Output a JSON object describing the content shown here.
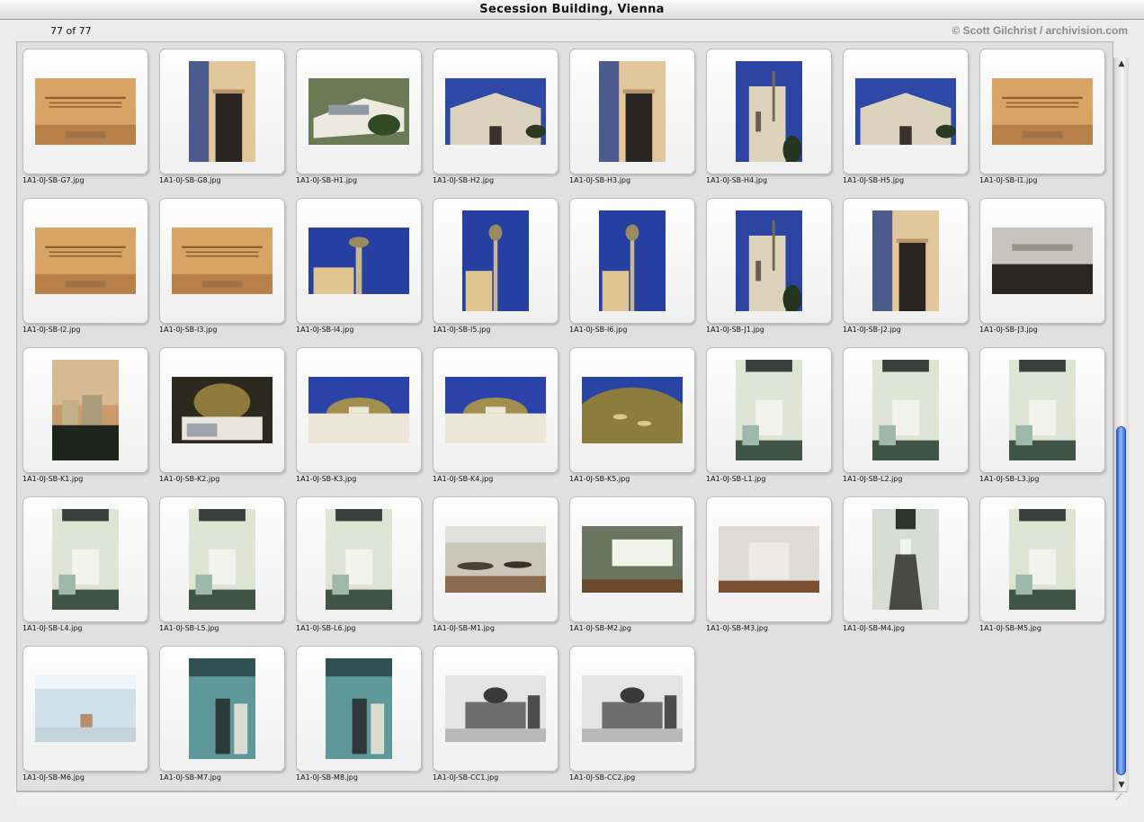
{
  "window": {
    "title": "Secession Building, Vienna"
  },
  "status": {
    "count": "77 of 77",
    "credit": "© Scott Gilchrist / archivision.com"
  },
  "thumbnails": [
    {
      "file": "1A1-0J-SB-G7.jpg",
      "orient": "land",
      "scene": "facade"
    },
    {
      "file": "1A1-0J-SB-G8.jpg",
      "orient": "port",
      "scene": "doorway"
    },
    {
      "file": "1A1-0J-SB-H1.jpg",
      "orient": "land",
      "scene": "roof-aerial"
    },
    {
      "file": "1A1-0J-SB-H2.jpg",
      "orient": "land",
      "scene": "building-sky"
    },
    {
      "file": "1A1-0J-SB-H3.jpg",
      "orient": "port",
      "scene": "doorway"
    },
    {
      "file": "1A1-0J-SB-H4.jpg",
      "orient": "port",
      "scene": "tower-sky"
    },
    {
      "file": "1A1-0J-SB-H5.jpg",
      "orient": "land",
      "scene": "building-sky"
    },
    {
      "file": "1A1-0J-SB-I1.jpg",
      "orient": "land",
      "scene": "facade"
    },
    {
      "file": "1A1-0J-SB-I2.jpg",
      "orient": "land",
      "scene": "facade"
    },
    {
      "file": "1A1-0J-SB-I3.jpg",
      "orient": "land",
      "scene": "facade"
    },
    {
      "file": "1A1-0J-SB-I4.jpg",
      "orient": "land",
      "scene": "pole-sky"
    },
    {
      "file": "1A1-0J-SB-I5.jpg",
      "orient": "port",
      "scene": "pole-sky"
    },
    {
      "file": "1A1-0J-SB-I6.jpg",
      "orient": "port",
      "scene": "pole-sky"
    },
    {
      "file": "1A1-0J-SB-J1.jpg",
      "orient": "port",
      "scene": "tower-sky"
    },
    {
      "file": "1A1-0J-SB-J2.jpg",
      "orient": "port",
      "scene": "doorway"
    },
    {
      "file": "1A1-0J-SB-J3.jpg",
      "orient": "land",
      "scene": "sign"
    },
    {
      "file": "1A1-0J-SB-K1.jpg",
      "orient": "port",
      "scene": "city-dusk"
    },
    {
      "file": "1A1-0J-SB-K2.jpg",
      "orient": "land",
      "scene": "dome-dark"
    },
    {
      "file": "1A1-0J-SB-K3.jpg",
      "orient": "land",
      "scene": "dome"
    },
    {
      "file": "1A1-0J-SB-K4.jpg",
      "orient": "land",
      "scene": "dome"
    },
    {
      "file": "1A1-0J-SB-K5.jpg",
      "orient": "land",
      "scene": "dome-close"
    },
    {
      "file": "1A1-0J-SB-L1.jpg",
      "orient": "port",
      "scene": "interior-green"
    },
    {
      "file": "1A1-0J-SB-L2.jpg",
      "orient": "port",
      "scene": "interior-green"
    },
    {
      "file": "1A1-0J-SB-L3.jpg",
      "orient": "port",
      "scene": "interior-green"
    },
    {
      "file": "1A1-0J-SB-L4.jpg",
      "orient": "port",
      "scene": "interior-green"
    },
    {
      "file": "1A1-0J-SB-L5.jpg",
      "orient": "port",
      "scene": "interior-green"
    },
    {
      "file": "1A1-0J-SB-L6.jpg",
      "orient": "port",
      "scene": "interior-green"
    },
    {
      "file": "1A1-0J-SB-M1.jpg",
      "orient": "land",
      "scene": "gallery"
    },
    {
      "file": "1A1-0J-SB-M2.jpg",
      "orient": "land",
      "scene": "room-window"
    },
    {
      "file": "1A1-0J-SB-M3.jpg",
      "orient": "land",
      "scene": "room-white"
    },
    {
      "file": "1A1-0J-SB-M4.jpg",
      "orient": "port",
      "scene": "stair"
    },
    {
      "file": "1A1-0J-SB-M5.jpg",
      "orient": "port",
      "scene": "interior-green"
    },
    {
      "file": "1A1-0J-SB-M6.jpg",
      "orient": "land",
      "scene": "room-blue"
    },
    {
      "file": "1A1-0J-SB-M7.jpg",
      "orient": "port",
      "scene": "room-teal"
    },
    {
      "file": "1A1-0J-SB-M8.jpg",
      "orient": "port",
      "scene": "room-teal"
    },
    {
      "file": "1A1-0J-SB-CC1.jpg",
      "orient": "land",
      "scene": "bw"
    },
    {
      "file": "1A1-0J-SB-CC2.jpg",
      "orient": "land",
      "scene": "bw"
    }
  ]
}
